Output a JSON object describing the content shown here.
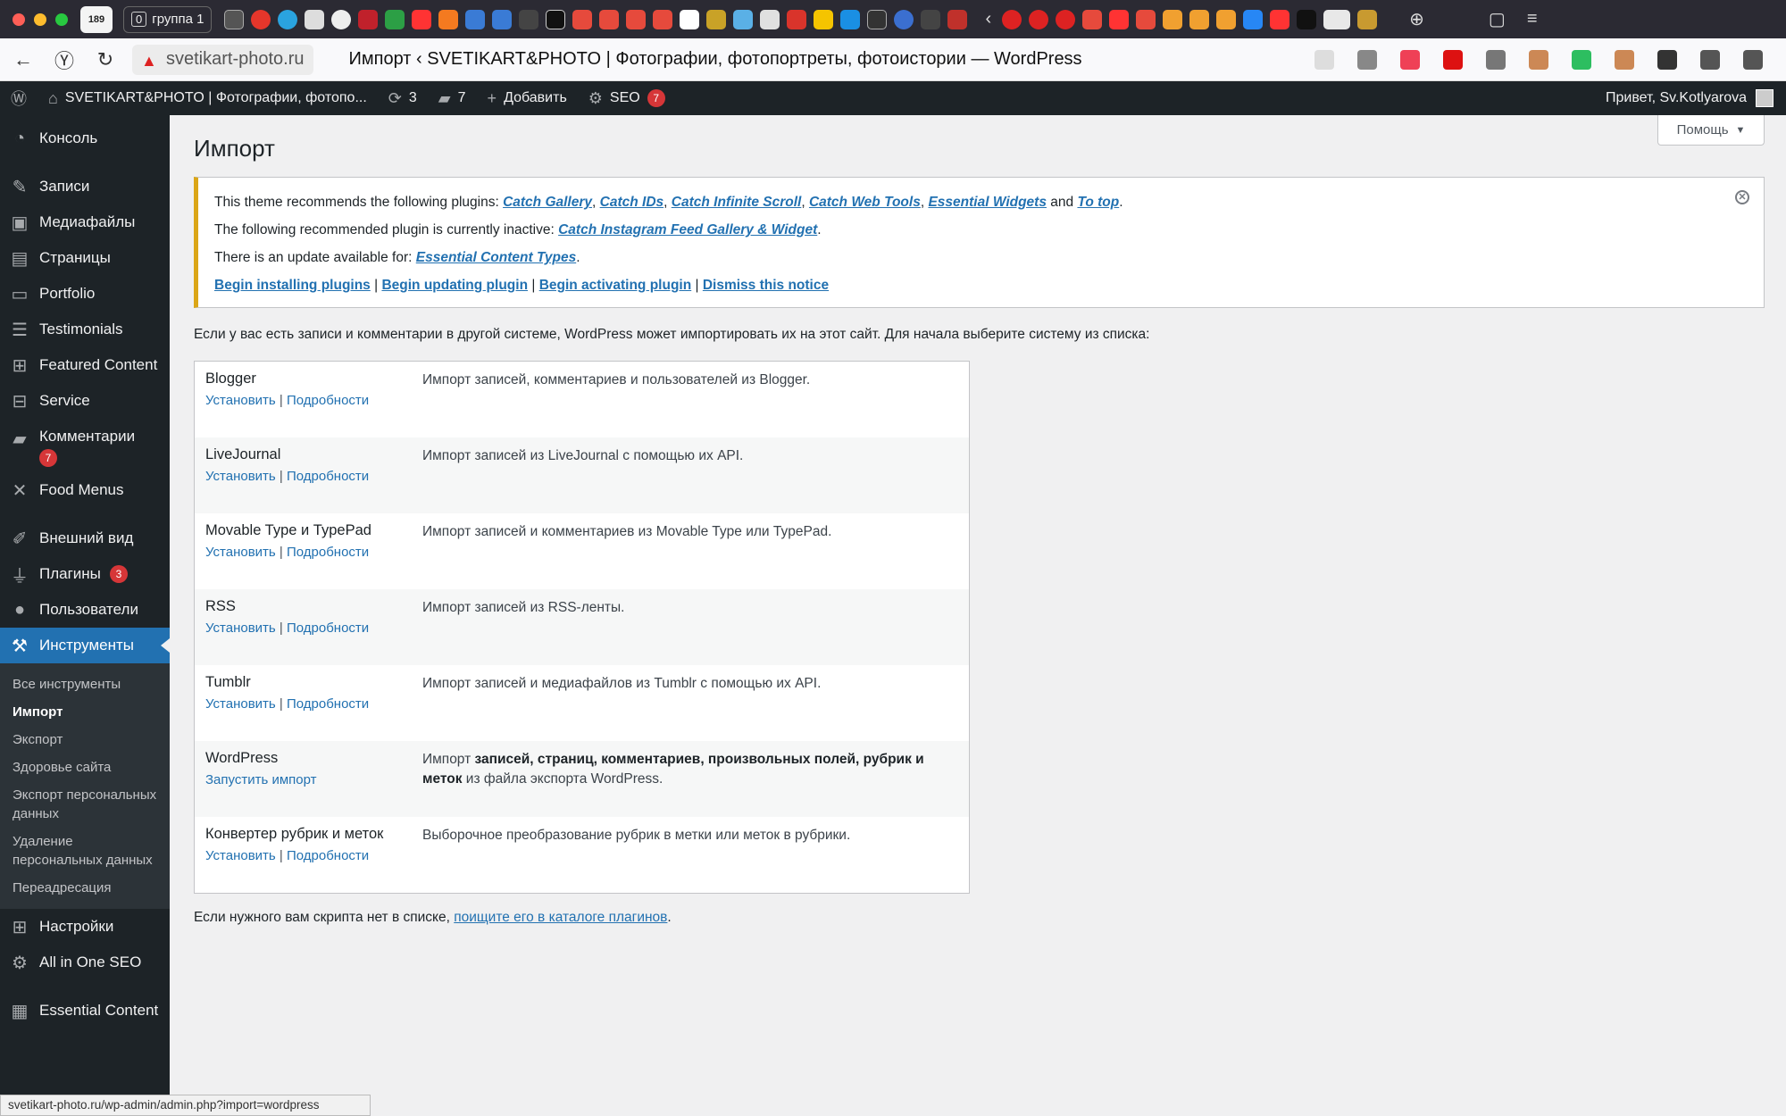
{
  "browser": {
    "group_count": "0",
    "group_label": "группа 1",
    "home_badge": "189",
    "url": "svetikart-photo.ru",
    "page_title": "Импорт ‹ SVETIKART&PHOTO | Фотографии, фотопортреты, фотоистории — WordPress",
    "status_url": "svetikart-photo.ru/wp-admin/admin.php?import=wordpress",
    "accent": "#2271b1"
  },
  "adminbar": {
    "site_name": "SVETIKART&PHOTO | Фотографии, фотопо...",
    "updates": "3",
    "comments": "7",
    "add": "Добавить",
    "seo": "SEO",
    "seo_count": "7",
    "greeting": "Привет, Sv.Kotlyarova"
  },
  "sidebar": {
    "console": "Консоль",
    "posts": "Записи",
    "media": "Медиафайлы",
    "pages": "Страницы",
    "portfolio": "Portfolio",
    "testimonials": "Testimonials",
    "featured": "Featured Content",
    "service": "Service",
    "comments": "Комментарии",
    "comments_count": "7",
    "food": "Food Menus",
    "appearance": "Внешний вид",
    "plugins": "Плагины",
    "plugins_count": "3",
    "users": "Пользователи",
    "tools": "Инструменты",
    "sub": {
      "all": "Все инструменты",
      "import": "Импорт",
      "export": "Экспорт",
      "health": "Здоровье сайта",
      "export_personal": "Экспорт персональных данных",
      "delete_personal": "Удаление персональных данных",
      "redirect": "Переадресация"
    },
    "settings": "Настройки",
    "aioseo": "All in One SEO",
    "essential": "Essential Content"
  },
  "main": {
    "help": "Помощь",
    "title": "Импорт",
    "notice": {
      "l1_pre": "This theme recommends the following plugins: ",
      "p1": "Catch Gallery",
      "p2": "Catch IDs",
      "p3": "Catch Infinite Scroll",
      "p4": "Catch Web Tools",
      "p5": "Essential Widgets",
      "and": " and ",
      "p6": "To top",
      "l2_pre": "The following recommended plugin is currently inactive: ",
      "p7": "Catch Instagram Feed Gallery & Widget",
      "l3_pre": "There is an update available for: ",
      "p8": "Essential Content Types",
      "a1": "Begin installing plugins",
      "a2": "Begin updating plugin",
      "a3": "Begin activating plugin",
      "a4": "Dismiss this notice"
    },
    "intro": "Если у вас есть записи и комментарии в другой системе, WordPress может импортировать их на этот сайт. Для начала выберите систему из списка:",
    "install": "Установить",
    "details": "Подробности",
    "run_import": "Запустить импорт",
    "importers": [
      {
        "name": "Blogger",
        "desc": "Импорт записей, комментариев и пользователей из Blogger."
      },
      {
        "name": "LiveJournal",
        "desc": "Импорт записей из LiveJournal с помощью их API."
      },
      {
        "name": "Movable Type и TypePad",
        "desc": "Импорт записей и комментариев из Movable Type или TypePad."
      },
      {
        "name": "RSS",
        "desc": "Импорт записей из RSS-ленты."
      },
      {
        "name": "Tumblr",
        "desc": "Импорт записей и медиафайлов из Tumblr с помощью их API."
      },
      {
        "name": "WordPress",
        "desc_pre": "Импорт ",
        "desc_bold": "записей, страниц, комментариев, произвольных полей, рубрик и меток",
        "desc_post": " из файла экспорта WordPress."
      },
      {
        "name": "Конвертер рубрик и меток",
        "desc": "Выборочное преобразование рубрик в метки или меток в рубрики."
      }
    ],
    "footer_pre": "Если нужного вам скрипта нет в списке, ",
    "footer_link": "поищите его в каталоге плагинов"
  }
}
